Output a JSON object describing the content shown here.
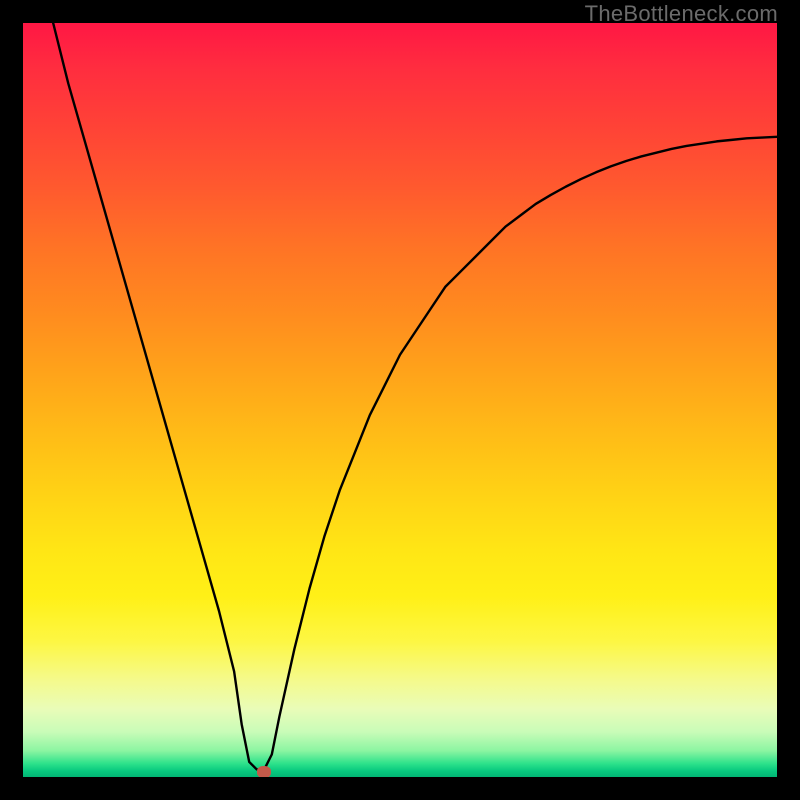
{
  "watermark": "TheBottleneck.com",
  "chart_data": {
    "type": "line",
    "title": "",
    "xlabel": "",
    "ylabel": "",
    "xlim": [
      0,
      100
    ],
    "ylim": [
      0,
      100
    ],
    "series": [
      {
        "name": "bottleneck-curve",
        "x": [
          4,
          6,
          8,
          10,
          12,
          14,
          16,
          18,
          20,
          22,
          24,
          26,
          28,
          29,
          30,
          31,
          32,
          33,
          34,
          36,
          38,
          40,
          42,
          44,
          46,
          48,
          50,
          52,
          54,
          56,
          58,
          60,
          62,
          64,
          66,
          68,
          70,
          72,
          74,
          76,
          78,
          80,
          82,
          84,
          86,
          88,
          90,
          92,
          94,
          96,
          98,
          100
        ],
        "y": [
          100,
          92,
          85,
          78,
          71,
          64,
          57,
          50,
          43,
          36,
          29,
          22,
          14,
          7,
          2,
          1,
          1,
          3,
          8,
          17,
          25,
          32,
          38,
          43,
          48,
          52,
          56,
          59,
          62,
          65,
          67,
          69,
          71,
          73,
          74.5,
          76,
          77.2,
          78.3,
          79.3,
          80.2,
          81,
          81.7,
          82.3,
          82.8,
          83.3,
          83.7,
          84,
          84.3,
          84.5,
          84.7,
          84.8,
          84.9
        ]
      }
    ],
    "marker": {
      "x": 32,
      "y": 0.6,
      "color": "#c35a4a"
    },
    "gradient": {
      "top": "#ff1744",
      "mid": "#ffe615",
      "bottom": "#02b574"
    }
  }
}
